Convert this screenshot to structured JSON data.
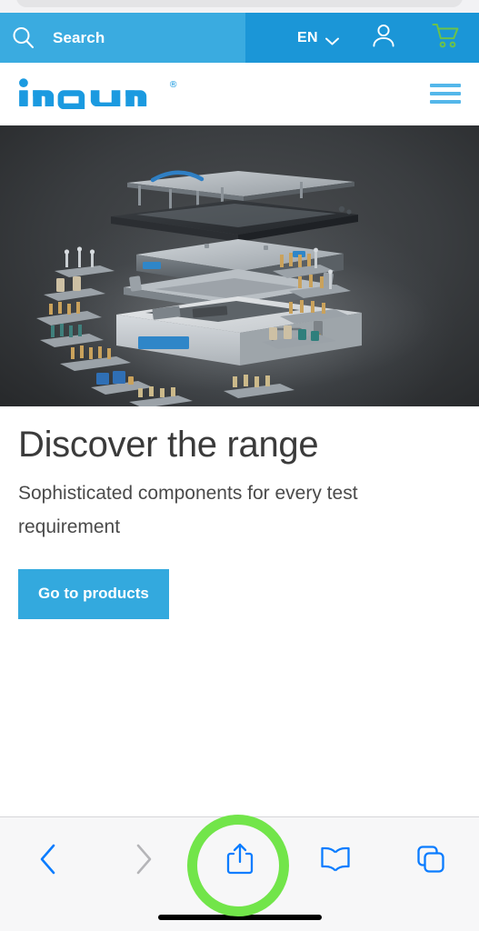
{
  "browser": {
    "back_icon": "chevron-left-icon",
    "forward_icon": "chevron-right-icon",
    "share_icon": "share-icon",
    "bookmarks_icon": "book-icon",
    "tabs_icon": "tabs-icon",
    "back_enabled_color": "#0a7cff",
    "forward_disabled_color": "#b5b5b8",
    "toolbar_bg": "#f7f7f8",
    "annotation_ring_color": "#72e54a",
    "annotation_target": "share-button"
  },
  "utility_bar": {
    "search": {
      "icon": "search-icon",
      "placeholder": "Search",
      "value": "Search",
      "bg": "#3aabe0"
    },
    "language": {
      "code": "EN",
      "chevron_icon": "chevron-down-icon"
    },
    "account": {
      "icon": "user-icon",
      "color": "#ffffff"
    },
    "cart": {
      "icon": "cart-icon",
      "color": "#6cc24a"
    },
    "bg": "#1b96d7"
  },
  "header": {
    "logo_text": "ingun",
    "logo_trademark": "®",
    "logo_color": "#1b9ae0",
    "menu_icon": "hamburger-menu-icon",
    "menu_color": "#54b7ea"
  },
  "hero": {
    "alt": "Exploded view of a modular test fixture system with stacked plates and test probe accessories on a dark background"
  },
  "content": {
    "headline": "Discover the range",
    "subline": "Sophisticated components for every test requirement",
    "cta_label": "Go to products",
    "cta_color": "#33a9de"
  }
}
